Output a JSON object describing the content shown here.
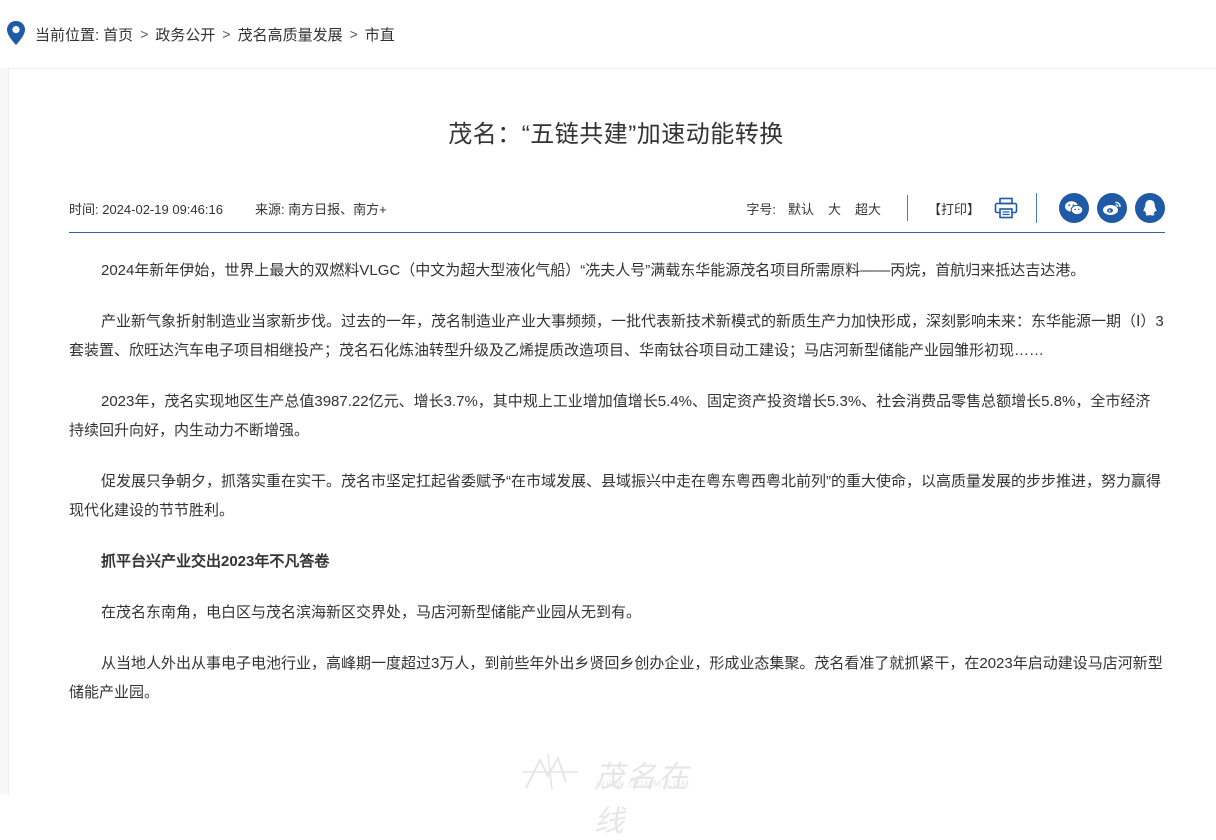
{
  "breadcrumb": {
    "label": "当前位置:",
    "items": [
      "首页",
      "政务公开",
      "茂名高质量发展",
      "市直"
    ],
    "separator": ">"
  },
  "article": {
    "title": "茂名：“五链共建”加速动能转换",
    "time": "时间: 2024-02-19 09:46:16",
    "source": "来源: 南方日报、南方+",
    "font_size": {
      "label": "字号:",
      "options": [
        "默认",
        "大",
        "超大"
      ]
    },
    "print_label": "【打印】",
    "share_icons": [
      "wechat-icon",
      "weibo-icon",
      "qq-icon"
    ],
    "paragraphs": [
      "2024年新年伊始，世界上最大的双燃料VLGC（中文为超大型液化气船）“冼夫人号”满载东华能源茂名项目所需原料——丙烷，首航归来抵达吉达港。",
      "产业新气象折射制造业当家新步伐。过去的一年，茂名制造业产业大事频频，一批代表新技术新模式的新质生产力加快形成，深刻影响未来：东华能源一期（Ⅰ）3套装置、欣旺达汽车电子项目相继投产；茂名石化炼油转型升级及乙烯提质改造项目、华南钛谷项目动工建设；马店河新型储能产业园雏形初现……",
      "2023年，茂名实现地区生产总值3987.22亿元、增长3.7%，其中规上工业增加值增长5.4%、固定资产投资增长5.3%、社会消费品零售总额增长5.8%，全市经济持续回升向好，内生动力不断增强。",
      "促发展只争朝夕，抓落实重在实干。茂名市坚定扛起省委赋予“在市域发展、县域振兴中走在粤东粤西粤北前列”的重大使命，以高质量发展的步步推进，努力赢得现代化建设的节节胜利。",
      "抓平台兴产业交出2023年不凡答卷",
      "在茂名东南角，电白区与茂名滨海新区交界处，马店河新型储能产业园从无到有。",
      "从当地人外出从事电子电池行业，高峰期一度超过3万人，到前些年外出乡贤回乡创办企业，形成业态集聚。茂名看准了就抓紧干，在2023年启动建设马店河新型储能产业园。"
    ]
  },
  "watermark": {
    "text": "茂名在线",
    "url": "WWW.GDMM.COM"
  },
  "colors": {
    "accent": "#1f5aa6",
    "divider": "#2f64ad",
    "text": "#333333"
  }
}
